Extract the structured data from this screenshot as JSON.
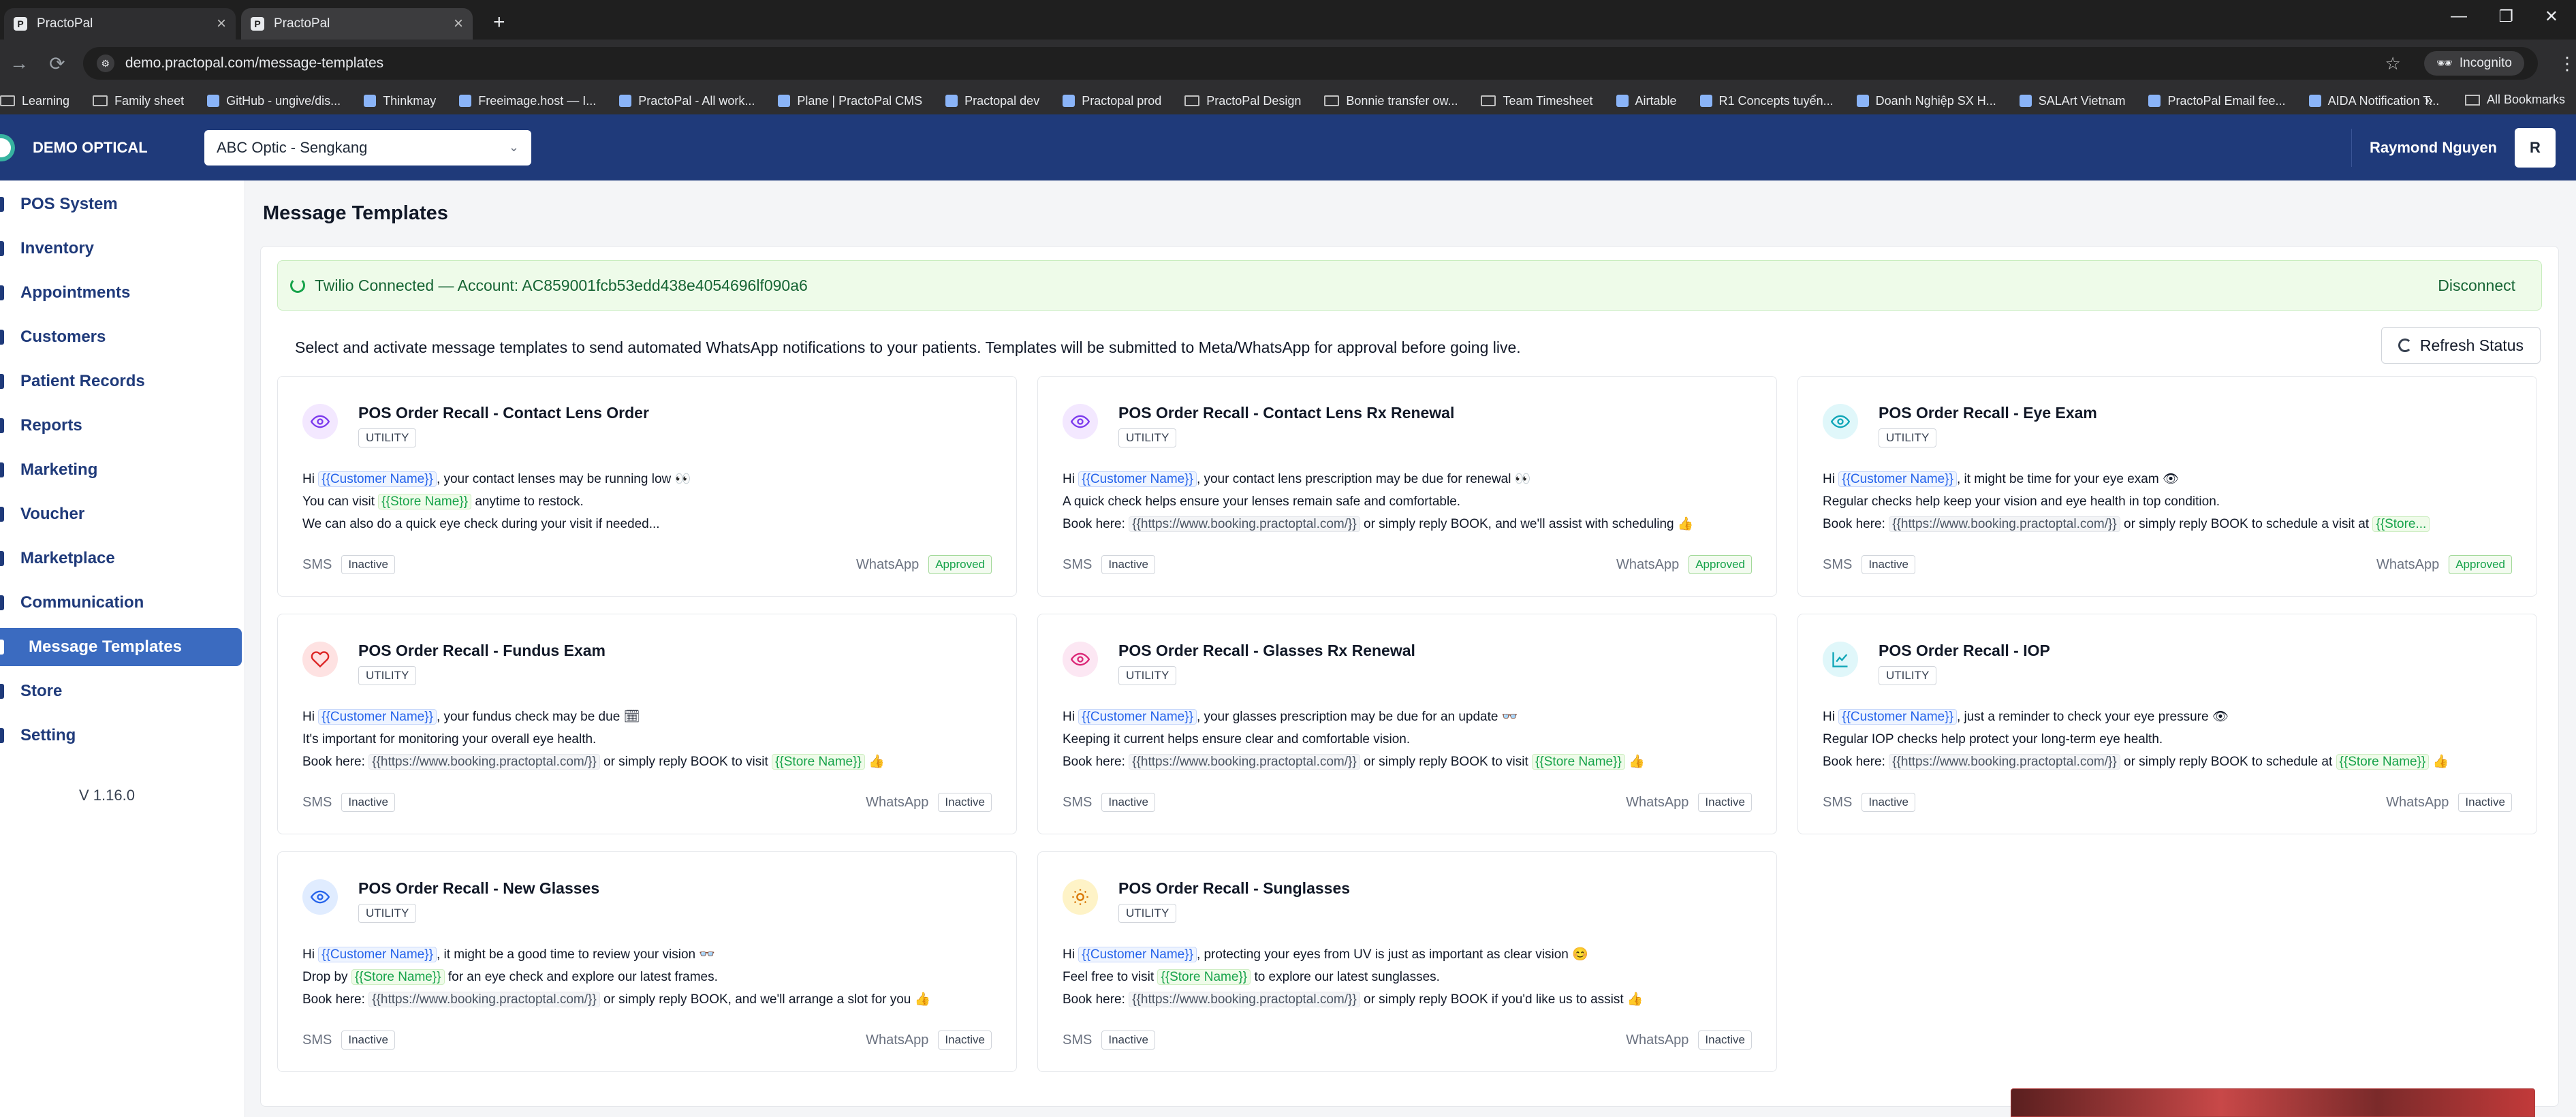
{
  "browser": {
    "tabs": [
      {
        "title": "PractoPal",
        "favicon": "P"
      },
      {
        "title": "PractoPal",
        "favicon": "P"
      }
    ],
    "new_tab": "+",
    "controls": {
      "minimize": "—",
      "maximize": "❐",
      "close": "✕"
    },
    "url": "demo.practopal.com/message-templates",
    "incognito": "Incognito",
    "bookmarks": [
      {
        "label": "Learning",
        "type": "folder"
      },
      {
        "label": "Family sheet",
        "type": "folder"
      },
      {
        "label": "GitHub - ungive/dis...",
        "type": "site"
      },
      {
        "label": "Thinkmay",
        "type": "site"
      },
      {
        "label": "Freeimage.host — I...",
        "type": "site"
      },
      {
        "label": "PractoPal - All work...",
        "type": "site"
      },
      {
        "label": "Plane | PractoPal CMS",
        "type": "site"
      },
      {
        "label": "Practopal dev",
        "type": "site"
      },
      {
        "label": "Practopal prod",
        "type": "site"
      },
      {
        "label": "PractoPal Design",
        "type": "folder"
      },
      {
        "label": "Bonnie transfer ow...",
        "type": "folder"
      },
      {
        "label": "Team Timesheet",
        "type": "folder"
      },
      {
        "label": "Airtable",
        "type": "site"
      },
      {
        "label": "R1 Concepts tuyển...",
        "type": "site"
      },
      {
        "label": "Doanh Nghiệp SX H...",
        "type": "site"
      },
      {
        "label": "SALArt Vietnam",
        "type": "site"
      },
      {
        "label": "PractoPal Email fee...",
        "type": "site"
      },
      {
        "label": "AIDA Notification T...",
        "type": "site"
      }
    ],
    "more": "»",
    "all_bookmarks": "All Bookmarks"
  },
  "header": {
    "brand": "DEMO OPTICAL",
    "store": "ABC Optic - Sengkang",
    "user_name": "Raymond Nguyen",
    "avatar": "R"
  },
  "sidebar": {
    "items": [
      {
        "label": "POS System",
        "active": false
      },
      {
        "label": "Inventory",
        "active": false
      },
      {
        "label": "Appointments",
        "active": false
      },
      {
        "label": "Customers",
        "active": false
      },
      {
        "label": "Patient Records",
        "active": false
      },
      {
        "label": "Reports",
        "active": false
      },
      {
        "label": "Marketing",
        "active": false
      },
      {
        "label": "Voucher",
        "active": false
      },
      {
        "label": "Marketplace",
        "active": false
      },
      {
        "label": "Communication",
        "active": false
      },
      {
        "label": "Message Templates",
        "active": true
      },
      {
        "label": "Store",
        "active": false
      },
      {
        "label": "Setting",
        "active": false
      }
    ],
    "version": "V 1.16.0"
  },
  "main": {
    "title": "Message Templates",
    "twilio_status": "Twilio Connected — Account: AC859001fcb53edd438e4054696lf090a6",
    "disconnect": "Disconnect",
    "intro": "Select and activate message templates to send automated WhatsApp notifications to your patients. Templates will be submitted to Meta/WhatsApp for approval before going live.",
    "refresh": "Refresh Status",
    "sms_label": "SMS",
    "whatsapp_label": "WhatsApp",
    "hi": "Hi",
    "book_here": "Book here:",
    "customer_ph": "{{Customer Name}}",
    "store_ph": "{{Store Name}}",
    "booking_ph": "{{https://www.booking.practoptal.com/}}"
  },
  "templates": [
    {
      "title": "POS Order Recall - Contact Lens Order",
      "category": "UTILITY",
      "icon": "eye-icon",
      "icon_color": "#7c3aed",
      "icon_bg": "#f3e8ff",
      "l1": ", your contact lenses may be running low 👀",
      "l2_pre": "You can visit",
      "l2_post": "anytime to restock.",
      "l3": "We can also do a quick eye check during your visit if needed...",
      "sms": "Inactive",
      "whatsapp": "Approved"
    },
    {
      "title": "POS Order Recall - Contact Lens Rx Renewal",
      "category": "UTILITY",
      "icon": "eye-icon",
      "icon_color": "#7c3aed",
      "icon_bg": "#f3e8ff",
      "l1": ", your contact lens prescription may be due for renewal 👀",
      "l2": "A quick check helps ensure your lenses remain safe and comfortable.",
      "l3_post": "or simply reply BOOK, and we'll assist with scheduling 👍",
      "sms": "Inactive",
      "whatsapp": "Approved"
    },
    {
      "title": "POS Order Recall - Eye Exam",
      "category": "UTILITY",
      "icon": "eye-icon",
      "icon_color": "#0ea5b7",
      "icon_bg": "#e0f7fa",
      "l1": ", it might be time for your eye exam 👁",
      "l2": "Regular checks help keep your vision and eye health in top condition.",
      "l3_post": "or simply reply BOOK to schedule a visit at",
      "l3_tail": "{{Store...",
      "sms": "Inactive",
      "whatsapp": "Approved"
    },
    {
      "title": "POS Order Recall - Fundus Exam",
      "category": "UTILITY",
      "icon": "heart-icon",
      "icon_color": "#dc2626",
      "icon_bg": "#fee2e2",
      "l1": ", your fundus check may be due 🗓",
      "l2": "It's important for monitoring your overall eye health.",
      "l3_post": "or simply reply BOOK to visit",
      "l3_end": "👍",
      "sms": "Inactive",
      "whatsapp": "Inactive"
    },
    {
      "title": "POS Order Recall - Glasses Rx Renewal",
      "category": "UTILITY",
      "icon": "eye-icon",
      "icon_color": "#db2777",
      "icon_bg": "#fce7f3",
      "l1": ", your glasses prescription may be due for an update 👓",
      "l2": "Keeping it current helps ensure clear and comfortable vision.",
      "l3_post": "or simply reply BOOK to visit",
      "l3_end": "👍",
      "sms": "Inactive",
      "whatsapp": "Inactive"
    },
    {
      "title": "POS Order Recall - IOP",
      "category": "UTILITY",
      "icon": "chart-icon",
      "icon_color": "#0ea5b7",
      "icon_bg": "#e0f7fa",
      "l1": ", just a reminder to check your eye pressure 👁",
      "l2": "Regular IOP checks help protect your long-term eye health.",
      "l3_post": "or simply reply BOOK to schedule at",
      "l3_end": "👍",
      "sms": "Inactive",
      "whatsapp": "Inactive"
    },
    {
      "title": "POS Order Recall - New Glasses",
      "category": "UTILITY",
      "icon": "eye-icon",
      "icon_color": "#2563eb",
      "icon_bg": "#e0ecff",
      "l1": ", it might be a good time to review your vision 👓",
      "l2_pre": "Drop by",
      "l2_post": "for an eye check and explore our latest frames.",
      "l3_post": "or simply reply BOOK, and we'll arrange a slot for you 👍",
      "sms": "Inactive",
      "whatsapp": "Inactive"
    },
    {
      "title": "POS Order Recall - Sunglasses",
      "category": "UTILITY",
      "icon": "sun-icon",
      "icon_color": "#d97706",
      "icon_bg": "#fef3c7",
      "l1": ", protecting your eyes from UV is just as important as clear vision 😊",
      "l2_pre": "Feel free to visit",
      "l2_post": "to explore our latest sunglasses.",
      "l3_post": "or simply reply BOOK if you'd like us to assist 👍",
      "sms": "Inactive",
      "whatsapp": "Inactive"
    }
  ]
}
